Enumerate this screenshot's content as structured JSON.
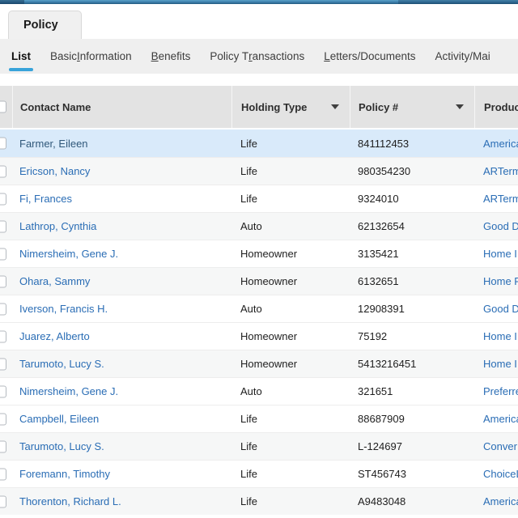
{
  "colors": {
    "topbar_blue": "#3b7ca9",
    "topbar_dark": "#235a7e",
    "nav_active_underline": "#38a3da",
    "link_blue": "#2a6db5",
    "selected_row_bg": "#d9eafa",
    "selected_row_link": "#30587a",
    "header_bg": "#e3e3e3",
    "strip_bg": "#efefef",
    "shaded_row_bg": "#f6f7f7"
  },
  "tab": {
    "label": "Policy"
  },
  "nav": {
    "items": [
      {
        "pre": "List",
        "accel": "",
        "post": "",
        "active": true
      },
      {
        "pre": "Basic ",
        "accel": "I",
        "post": "nformation",
        "active": false
      },
      {
        "pre": "",
        "accel": "B",
        "post": "enefits",
        "active": false
      },
      {
        "pre": "Policy T",
        "accel": "r",
        "post": "ansactions",
        "active": false
      },
      {
        "pre": "",
        "accel": "L",
        "post": "etters/Documents",
        "active": false
      },
      {
        "pre": "Activity/Mai",
        "accel": "",
        "post": "",
        "active": false
      }
    ]
  },
  "table": {
    "columns": [
      {
        "label": "Contact Name",
        "filter": false
      },
      {
        "label": "Holding Type",
        "filter": true
      },
      {
        "label": "Policy #",
        "filter": true
      },
      {
        "label": "Product",
        "filter": false
      }
    ],
    "rows": [
      {
        "name": "Farmer, Eileen",
        "holding_type": "Life",
        "policy_number": "841112453",
        "product": "America",
        "selected": true,
        "shaded": false
      },
      {
        "name": "Ericson, Nancy",
        "holding_type": "Life",
        "policy_number": "980354230",
        "product": "ARTerm",
        "selected": false,
        "shaded": true
      },
      {
        "name": "Fi, Frances",
        "holding_type": "Life",
        "policy_number": "9324010",
        "product": "ARTerm",
        "selected": false,
        "shaded": false
      },
      {
        "name": "Lathrop, Cynthia",
        "holding_type": "Auto",
        "policy_number": "62132654",
        "product": "Good D",
        "selected": false,
        "shaded": true
      },
      {
        "name": "Nimersheim, Gene J.",
        "holding_type": "Homeowner",
        "policy_number": "3135421",
        "product": "Home I",
        "selected": false,
        "shaded": false
      },
      {
        "name": "Ohara, Sammy",
        "holding_type": "Homeowner",
        "policy_number": "6132651",
        "product": "Home P",
        "selected": false,
        "shaded": true
      },
      {
        "name": "Iverson, Francis H.",
        "holding_type": "Auto",
        "policy_number": "12908391",
        "product": "Good D",
        "selected": false,
        "shaded": false
      },
      {
        "name": "Juarez, Alberto",
        "holding_type": "Homeowner",
        "policy_number": "75192",
        "product": "Home I",
        "selected": false,
        "shaded": false
      },
      {
        "name": "Tarumoto, Lucy S.",
        "holding_type": "Homeowner",
        "policy_number": "5413216451",
        "product": "Home I",
        "selected": false,
        "shaded": true
      },
      {
        "name": "Nimersheim, Gene J.",
        "holding_type": "Auto",
        "policy_number": "321651",
        "product": "Preferre",
        "selected": false,
        "shaded": false
      },
      {
        "name": "Campbell, Eileen",
        "holding_type": "Life",
        "policy_number": "88687909",
        "product": "America",
        "selected": false,
        "shaded": false
      },
      {
        "name": "Tarumoto, Lucy S.",
        "holding_type": "Life",
        "policy_number": "L-124697",
        "product": "Conver",
        "selected": false,
        "shaded": true
      },
      {
        "name": "Foremann, Timothy",
        "holding_type": "Life",
        "policy_number": "ST456743",
        "product": "ChoiceL",
        "selected": false,
        "shaded": false
      },
      {
        "name": "Thorenton, Richard L.",
        "holding_type": "Life",
        "policy_number": "A9483048",
        "product": "America",
        "selected": false,
        "shaded": true
      }
    ]
  }
}
